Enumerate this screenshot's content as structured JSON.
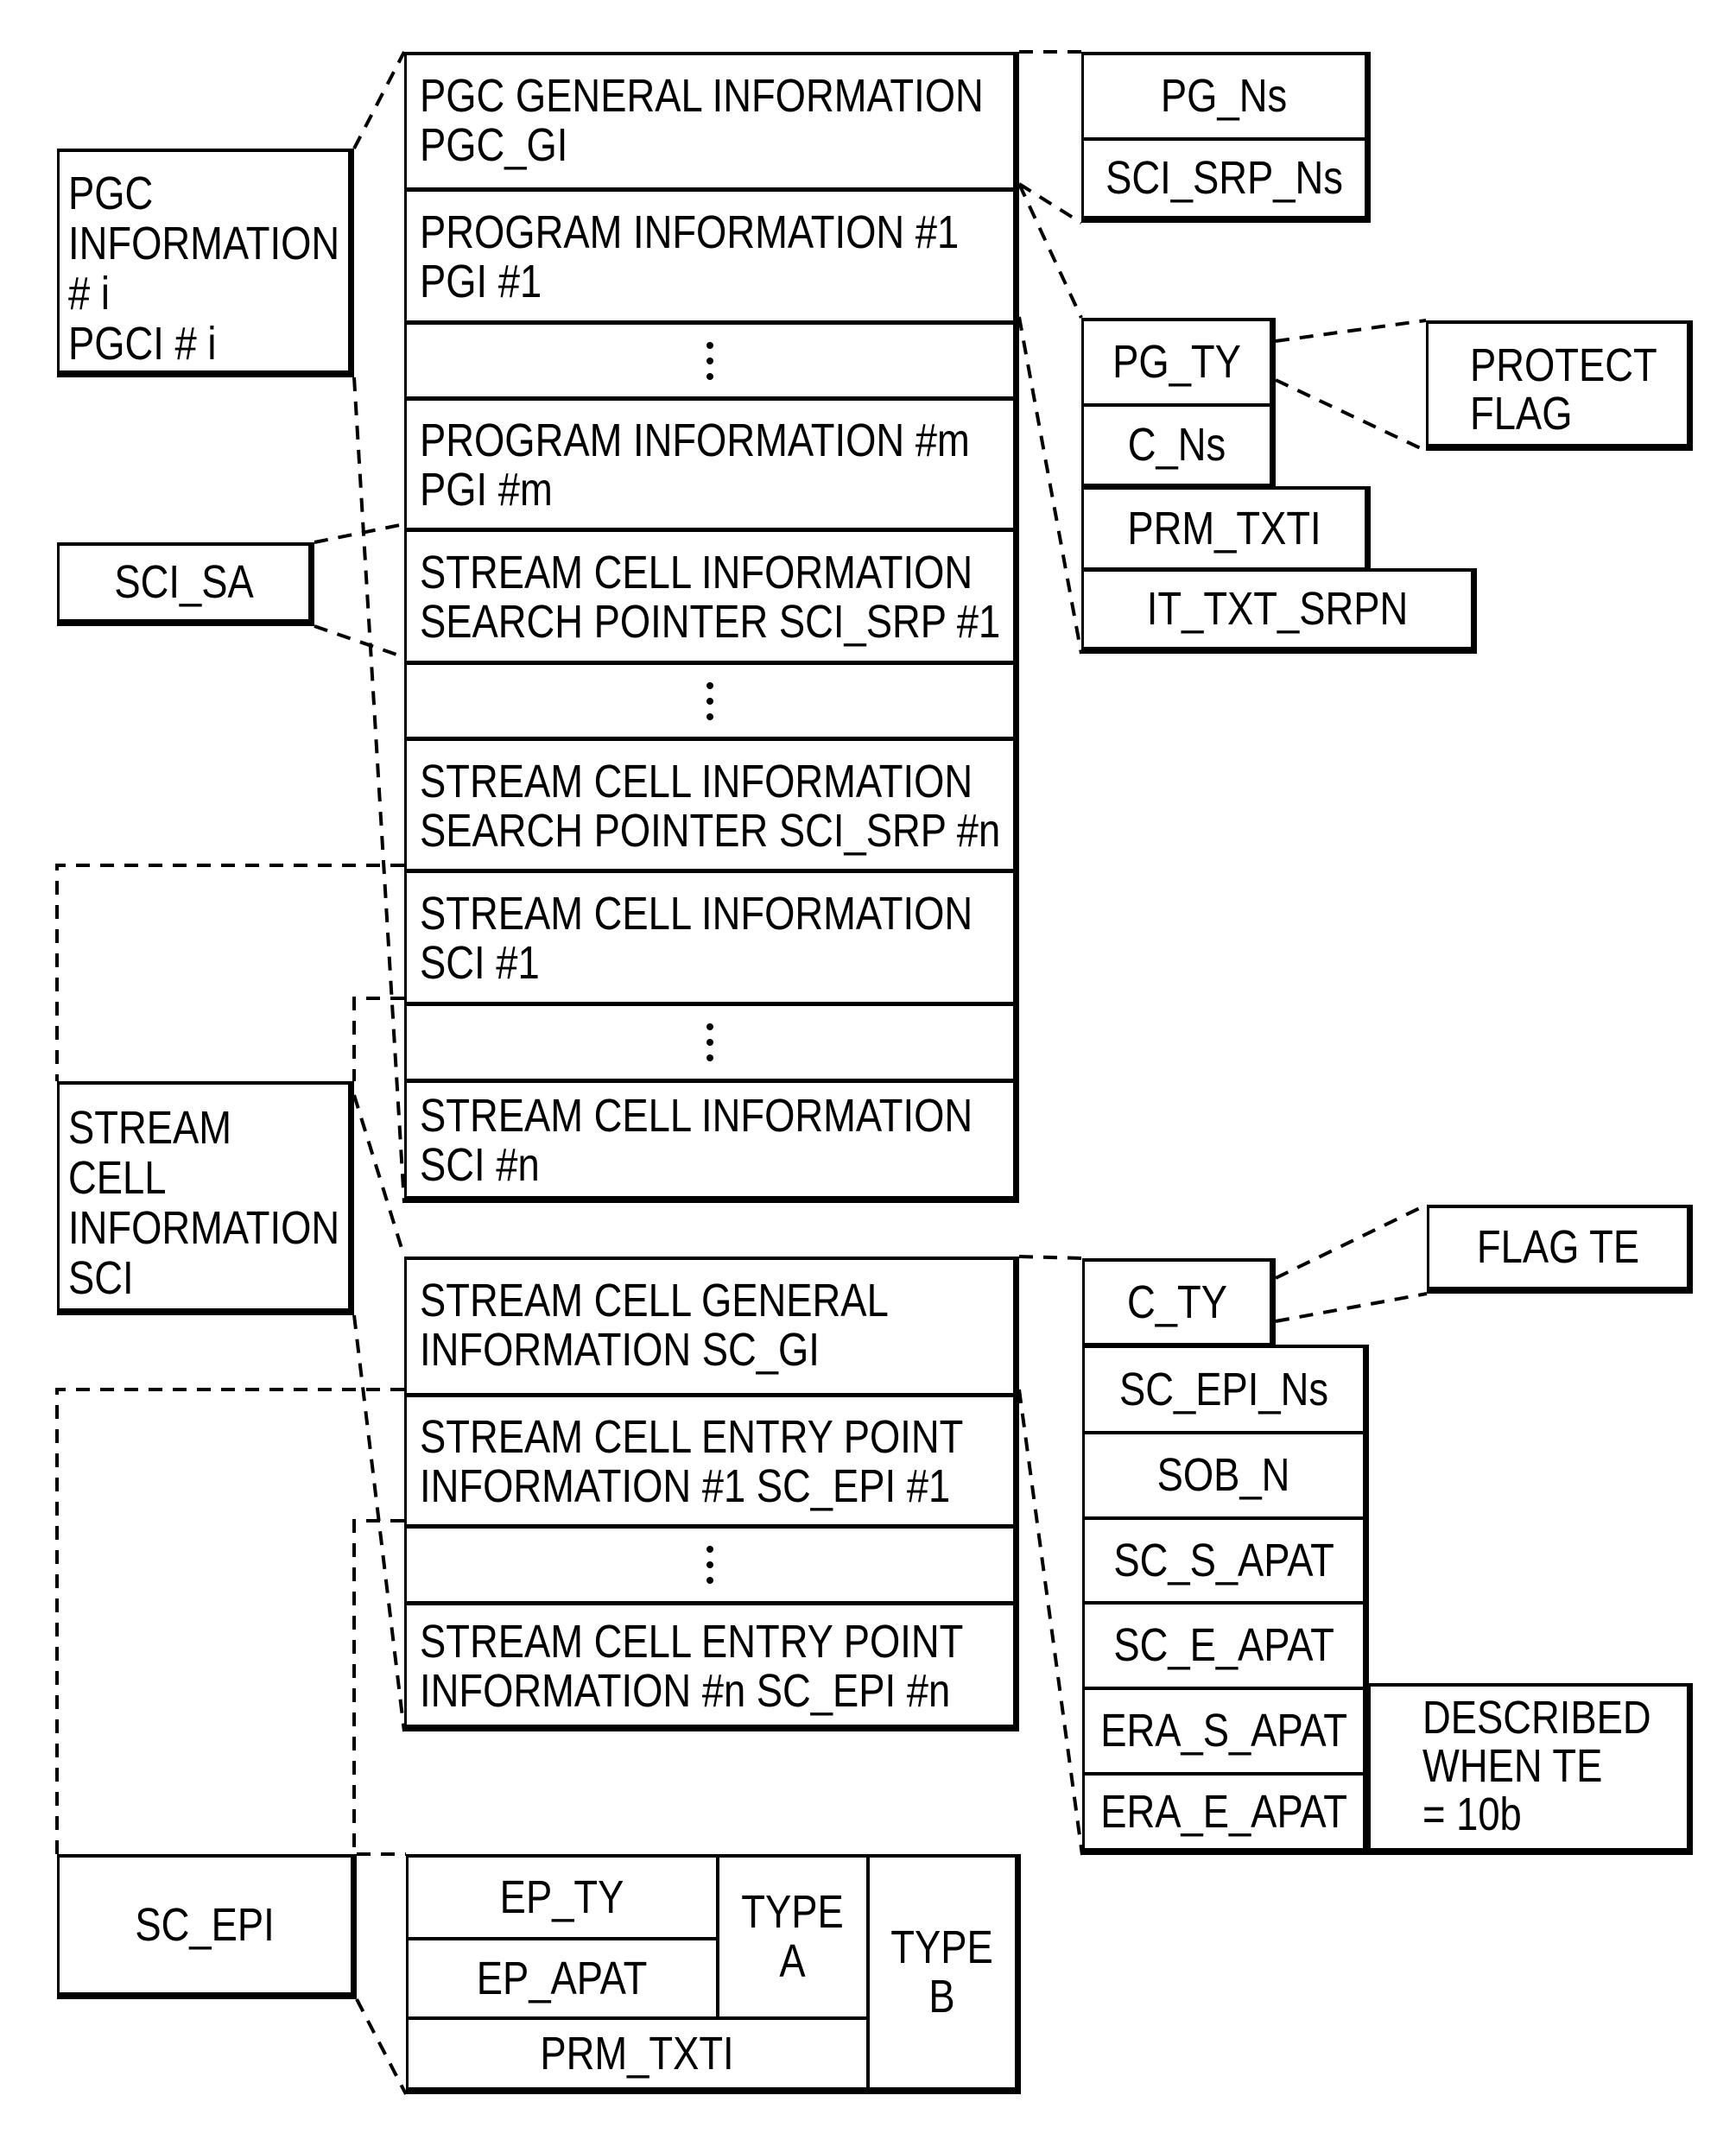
{
  "diagram": {
    "pgci_box": {
      "lines": [
        "PGC",
        "INFORMATION",
        "# i",
        "PGCI # i"
      ]
    },
    "sci_sa_box": {
      "label": "SCI_SA"
    },
    "sci_box": {
      "lines": [
        "STREAM",
        "CELL",
        "INFORMATION",
        "SCI"
      ]
    },
    "sc_epi_box": {
      "label": "SC_EPI"
    },
    "pgci_table": {
      "rows": [
        {
          "type": "text",
          "lines": [
            "PGC GENERAL INFORMATION",
            "PGC_GI"
          ]
        },
        {
          "type": "text",
          "lines": [
            "PROGRAM INFORMATION #1",
            "PGI #1"
          ]
        },
        {
          "type": "ellipsis"
        },
        {
          "type": "text",
          "lines": [
            "PROGRAM INFORMATION #m",
            "PGI #m"
          ]
        },
        {
          "type": "text",
          "lines": [
            "STREAM CELL INFORMATION",
            "SEARCH POINTER SCI_SRP #1"
          ]
        },
        {
          "type": "ellipsis"
        },
        {
          "type": "text",
          "lines": [
            "STREAM CELL INFORMATION",
            "SEARCH POINTER SCI_SRP #n"
          ]
        },
        {
          "type": "text",
          "lines": [
            "STREAM CELL INFORMATION",
            "SCI #1"
          ]
        },
        {
          "type": "ellipsis"
        },
        {
          "type": "text",
          "lines": [
            "STREAM CELL INFORMATION",
            "SCI #n"
          ]
        }
      ]
    },
    "sci_table": {
      "rows": [
        {
          "type": "text",
          "lines": [
            "STREAM CELL GENERAL",
            "INFORMATION SC_GI"
          ]
        },
        {
          "type": "text",
          "lines": [
            "STREAM CELL ENTRY POINT",
            "INFORMATION #1 SC_EPI #1"
          ]
        },
        {
          "type": "ellipsis"
        },
        {
          "type": "text",
          "lines": [
            "STREAM CELL ENTRY POINT",
            "INFORMATION #n SC_EPI #n"
          ]
        }
      ]
    },
    "pgc_gi_fields": [
      "PG_Ns",
      "SCI_SRP_Ns"
    ],
    "pgi_fields": [
      "PG_TY",
      "C_Ns",
      "PRM_TXTI",
      "IT_TXT_SRPN"
    ],
    "protect_flag": {
      "lines": [
        "PROTECT",
        "FLAG"
      ]
    },
    "sc_gi_fields": [
      "C_TY",
      "SC_EPI_Ns",
      "SOB_N",
      "SC_S_APAT",
      "SC_E_APAT",
      "ERA_S_APAT",
      "ERA_E_APAT"
    ],
    "flag_te": {
      "label": "FLAG TE"
    },
    "described_note": {
      "lines": [
        "DESCRIBED",
        "WHEN TE",
        "= 10b"
      ]
    },
    "sc_epi_table": {
      "ep_ty": "EP_TY",
      "ep_apat": "EP_APAT",
      "prm_txti": "PRM_TXTI",
      "type_a": [
        "TYPE",
        "A"
      ],
      "type_b": [
        "TYPE",
        "B"
      ]
    }
  }
}
